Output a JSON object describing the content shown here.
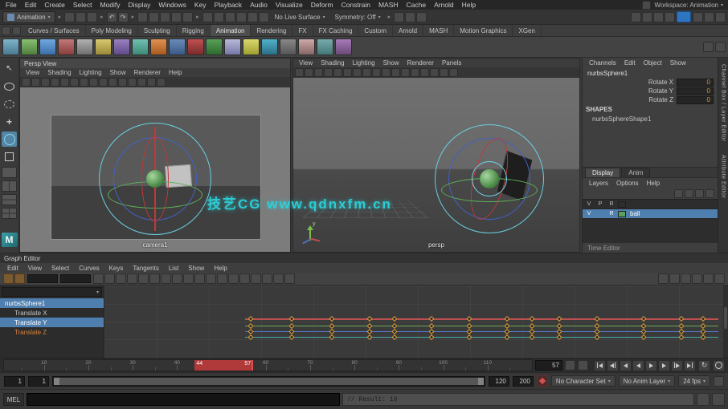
{
  "app": {
    "watermark": "技艺CG  www.qdnxfm.cn"
  },
  "menubar": {
    "items": [
      "File",
      "Edit",
      "Create",
      "Select",
      "Modify",
      "Display",
      "Windows",
      "Key",
      "Playback",
      "Audio",
      "Visualize",
      "Deform",
      "Constrain",
      "MASH",
      "Cache",
      "Arnold",
      "Help"
    ],
    "workspace": "Workspace: Animation"
  },
  "statusline": {
    "menu_set": "Animation",
    "live_surface": "No Live Surface",
    "symmetry": "Symmetry: Off"
  },
  "shelf": {
    "tabs": [
      "Curves / Surfaces",
      "Poly Modeling",
      "Sculpting",
      "Rigging",
      "Animation",
      "Rendering",
      "FX",
      "FX Caching",
      "Custom",
      "Arnold",
      "MASH",
      "Motion Graphics",
      "XGen"
    ]
  },
  "viewport_left": {
    "title": "Persp View",
    "menus": [
      "View",
      "Shading",
      "Lighting",
      "Show",
      "Renderer",
      "Help"
    ],
    "camera_label": "camera1"
  },
  "viewport_right": {
    "menus": [
      "View",
      "Shading",
      "Lighting",
      "Show",
      "Renderer",
      "Panels"
    ],
    "camera_label": "persp"
  },
  "channel_box": {
    "side_tabs": [
      "Channel Box / Layer Editor",
      "Attribute Editor"
    ],
    "menus": [
      "Channels",
      "Edit",
      "Object",
      "Show"
    ],
    "object_name": "nurbsSphere1",
    "channels": [
      {
        "name": "Rotate X",
        "value": "0"
      },
      {
        "name": "Rotate Y",
        "value": "0"
      },
      {
        "name": "Rotate Z",
        "value": "0"
      }
    ],
    "shapes_label": "SHAPES",
    "shape_name": "nurbsSphereShape1"
  },
  "layer_editor": {
    "tabs": [
      "Display",
      "Anim"
    ],
    "menus": [
      "Layers",
      "Options",
      "Help"
    ],
    "layers": [
      {
        "v": "V",
        "m": "P",
        "r": "R",
        "name": "",
        "selected": false,
        "swatch": ""
      },
      {
        "v": "V",
        "m": "",
        "r": "R",
        "name": "ball",
        "selected": true,
        "swatch": "#58a05c"
      }
    ],
    "footer": "Time Editor"
  },
  "graph_editor": {
    "title": "Graph Editor",
    "menus": [
      "Edit",
      "View",
      "Select",
      "Curves",
      "Keys",
      "Tangents",
      "List",
      "Show",
      "Help"
    ],
    "outliner": [
      {
        "name": "nurbsSphere1",
        "indent": 0,
        "selected": true,
        "accent": false
      },
      {
        "name": "Translate X",
        "indent": 1,
        "selected": false,
        "accent": false
      },
      {
        "name": "Translate Y",
        "indent": 1,
        "selected": true,
        "accent": false
      },
      {
        "name": "Translate Z",
        "indent": 1,
        "selected": false,
        "accent": true
      }
    ],
    "curves": [
      {
        "color": "#c05050",
        "y": 0.46
      },
      {
        "color": "#66aa55",
        "y": 0.55
      },
      {
        "color": "#5577cc",
        "y": 0.63
      },
      {
        "color": "#45b0aa",
        "y": 0.71
      }
    ],
    "key_x": [
      0.235,
      0.3,
      0.365,
      0.425,
      0.465,
      0.525,
      0.585,
      0.645,
      0.685,
      0.73,
      0.79,
      0.865,
      0.925,
      0.96
    ],
    "curve_start_x": 0.225,
    "curve_end_x": 0.985
  },
  "time_slider": {
    "frame_start": 1,
    "frame_end": 120,
    "tick_labels": [
      "10",
      "20",
      "30",
      "40",
      "50",
      "60",
      "70",
      "80",
      "90",
      "100",
      "110"
    ],
    "selection_start": 44,
    "selection_end": 57,
    "selection_start_label": "44",
    "selection_end_label": "57",
    "current_frame": "57"
  },
  "range_slider": {
    "anim_start": "1",
    "play_start": "1",
    "play_end": "120",
    "anim_end": "200",
    "character_set": "No Character Set",
    "anim_layer": "No Anim Layer",
    "fps": "24 fps"
  },
  "command_line": {
    "label": "MEL",
    "input_value": "",
    "result": "// Result: 10"
  }
}
